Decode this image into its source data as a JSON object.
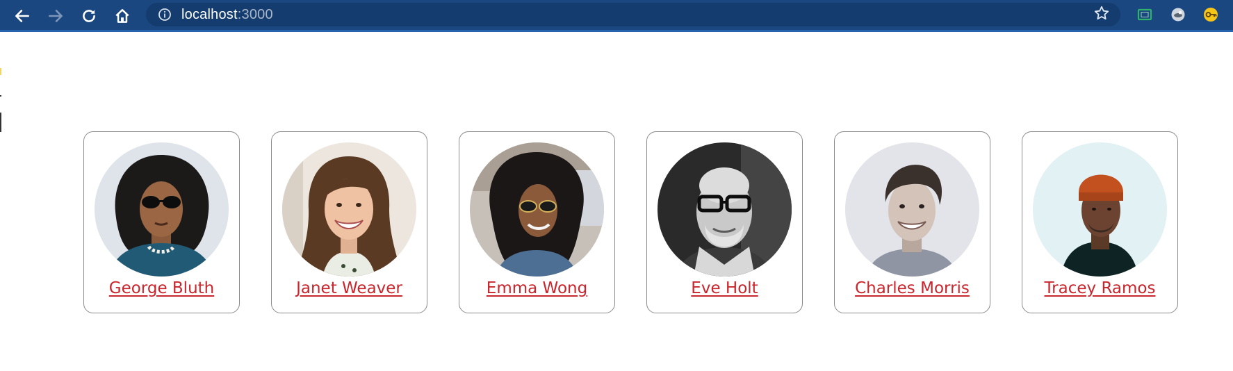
{
  "browser": {
    "url_host": "localhost",
    "url_port": ":3000",
    "icons": [
      "back-icon",
      "forward-icon",
      "reload-icon",
      "home-icon",
      "info-icon",
      "star-icon",
      "screenshot-extension-icon",
      "privacy-extension-icon",
      "password-extension-icon"
    ],
    "colors": {
      "toolbar": "#1a4780",
      "omnibox": "#143c6e"
    }
  },
  "users": [
    {
      "name": "George Bluth"
    },
    {
      "name": "Janet Weaver"
    },
    {
      "name": "Emma Wong"
    },
    {
      "name": "Eve Holt"
    },
    {
      "name": "Charles Morris"
    },
    {
      "name": "Tracey Ramos"
    }
  ],
  "colors": {
    "link": "#c8252d",
    "card_border": "#8a8a8a"
  }
}
